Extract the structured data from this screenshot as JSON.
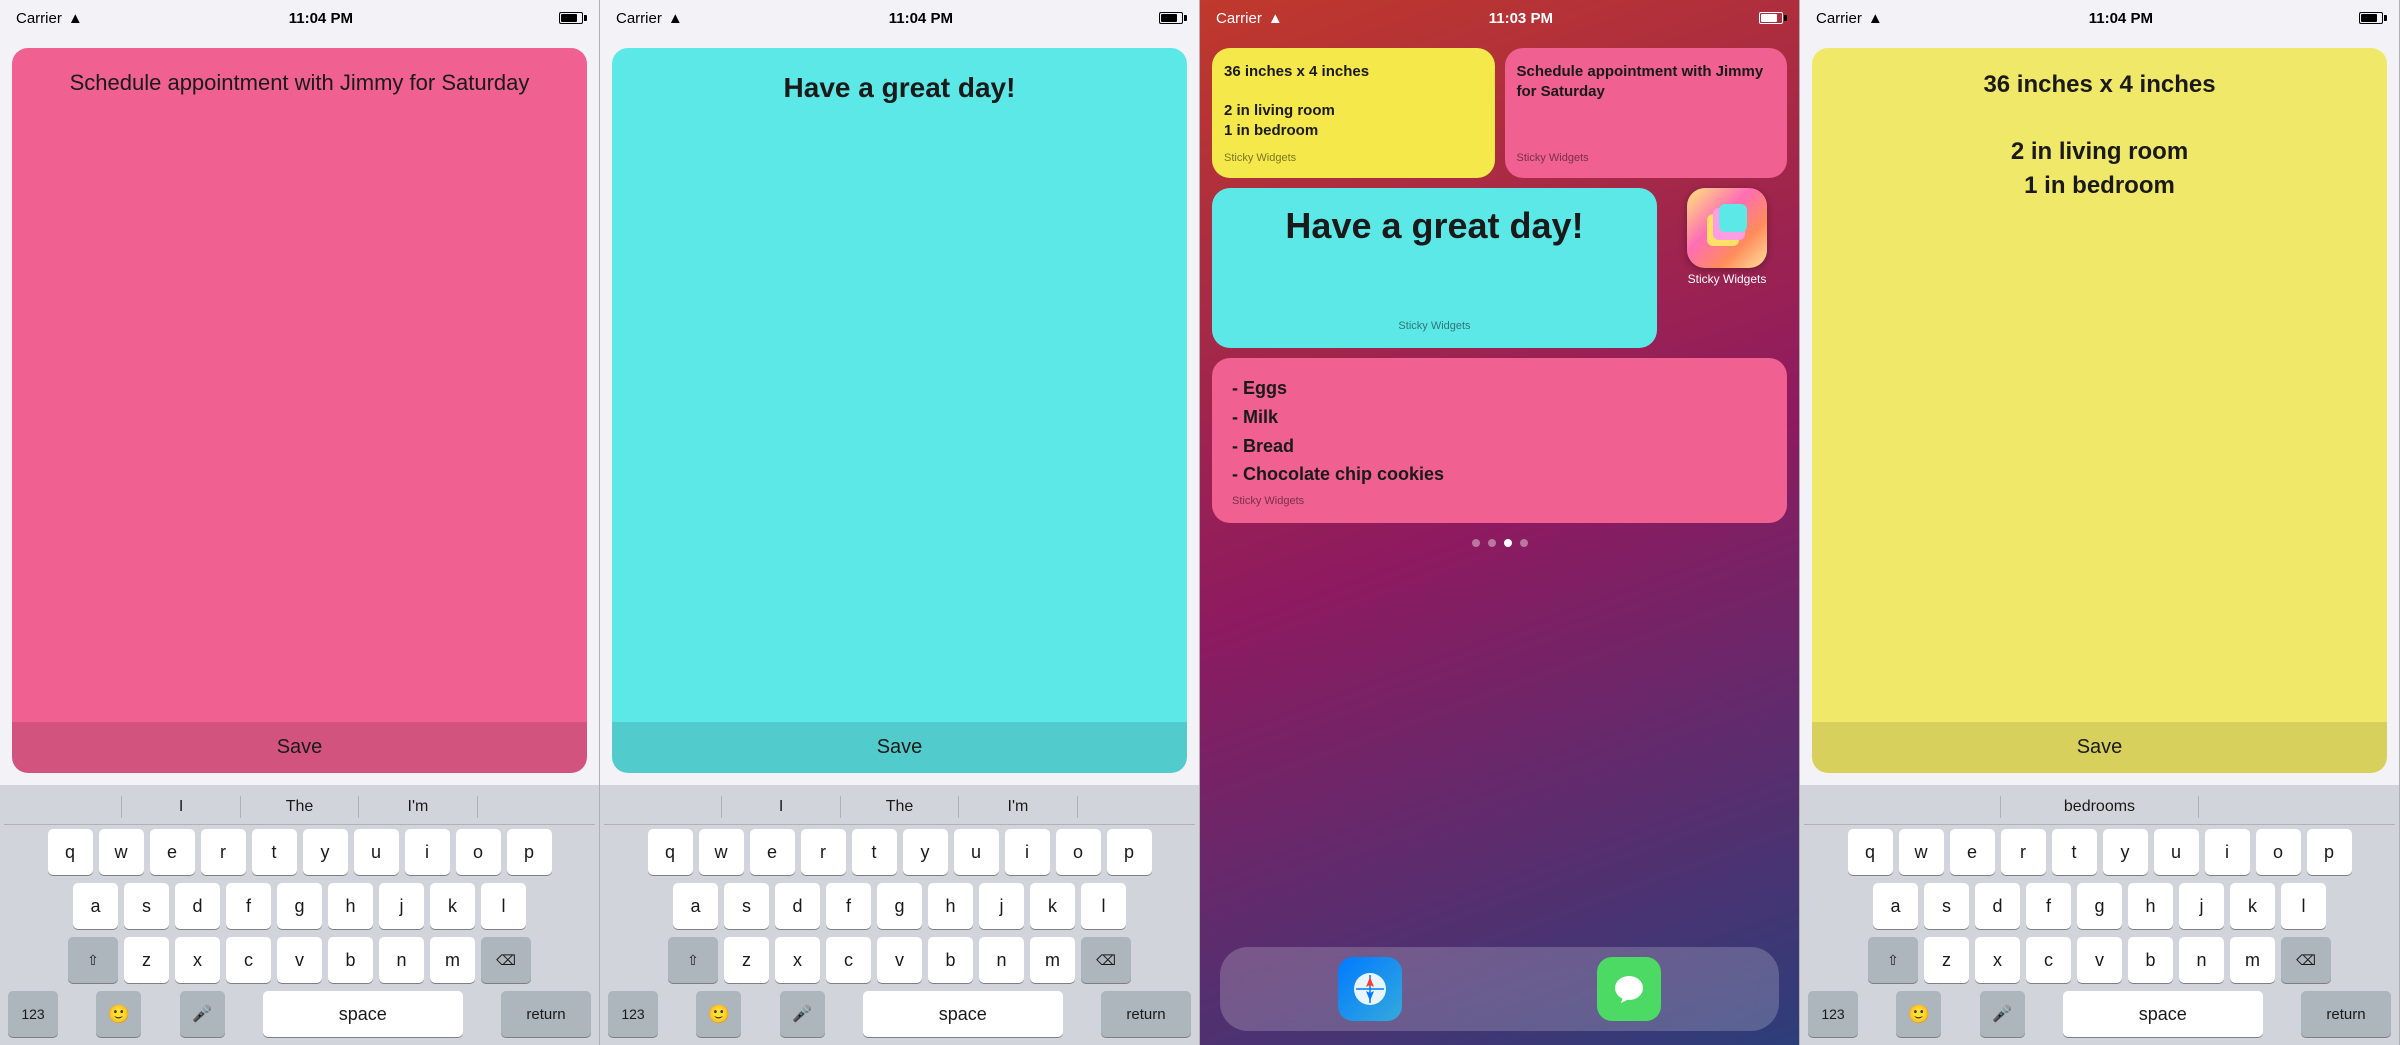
{
  "panels": [
    {
      "id": "panel1",
      "status": {
        "carrier": "Carrier",
        "time": "11:04 PM",
        "battery_full": true
      },
      "note": {
        "text": "Schedule appointment with Jimmy for Saturday",
        "color": "pink",
        "save_label": "Save"
      },
      "keyboard": {
        "suggestions": [
          "",
          "I",
          "",
          "The",
          "",
          "I'm",
          ""
        ],
        "rows": [
          [
            "q",
            "w",
            "e",
            "r",
            "t",
            "y",
            "u",
            "i",
            "o",
            "p"
          ],
          [
            "a",
            "s",
            "d",
            "f",
            "g",
            "h",
            "j",
            "k",
            "l"
          ],
          [
            "z",
            "x",
            "c",
            "v",
            "b",
            "n",
            "m"
          ]
        ]
      }
    },
    {
      "id": "panel2",
      "status": {
        "carrier": "Carrier",
        "time": "11:04 PM",
        "battery_full": true
      },
      "note": {
        "text": "Have a great day!",
        "color": "cyan",
        "save_label": "Save"
      },
      "keyboard": {
        "suggestions": [
          "I",
          "The",
          "I'm"
        ],
        "rows": [
          [
            "q",
            "w",
            "e",
            "r",
            "t",
            "y",
            "u",
            "i",
            "o",
            "p"
          ],
          [
            "a",
            "s",
            "d",
            "f",
            "g",
            "h",
            "j",
            "k",
            "l"
          ],
          [
            "z",
            "x",
            "c",
            "v",
            "b",
            "n",
            "m"
          ]
        ]
      }
    },
    {
      "id": "panel3",
      "status": {
        "carrier": "Carrier",
        "time": "11:03 PM",
        "battery_full": true
      },
      "widgets": [
        {
          "type": "small",
          "color": "yellow",
          "text": "36 inches x 4 inches\n\n2 in living room\n1 in bedroom",
          "label": "Sticky Widgets"
        },
        {
          "type": "small",
          "color": "pink",
          "text": "Schedule appointment with Jimmy for Saturday",
          "label": "Sticky Widgets"
        }
      ],
      "widget_large_cyan": {
        "text": "Have a great day!",
        "label": "Sticky Widgets"
      },
      "app_icon": {
        "label": "Sticky Widgets"
      },
      "widget_grocery": {
        "text": "- Eggs\n- Milk\n- Bread\n- Chocolate chip cookies",
        "label": "Sticky Widgets"
      },
      "page_dots": 4,
      "active_dot": 3,
      "dock": {
        "safari_label": "Safari",
        "messages_label": "Messages"
      }
    },
    {
      "id": "panel4",
      "status": {
        "carrier": "Carrier",
        "time": "11:04 PM",
        "battery_full": true
      },
      "note": {
        "text": "36 inches x 4 inches\n\n2 in living room\n1 in bedroom",
        "color": "yellow",
        "save_label": "Save"
      },
      "keyboard": {
        "suggestions": [
          "bedrooms"
        ],
        "rows": [
          [
            "q",
            "w",
            "e",
            "r",
            "t",
            "y",
            "u",
            "i",
            "o",
            "p"
          ],
          [
            "a",
            "s",
            "d",
            "f",
            "g",
            "h",
            "j",
            "k",
            "l"
          ],
          [
            "z",
            "x",
            "c",
            "v",
            "b",
            "n",
            "m"
          ]
        ]
      }
    }
  ]
}
